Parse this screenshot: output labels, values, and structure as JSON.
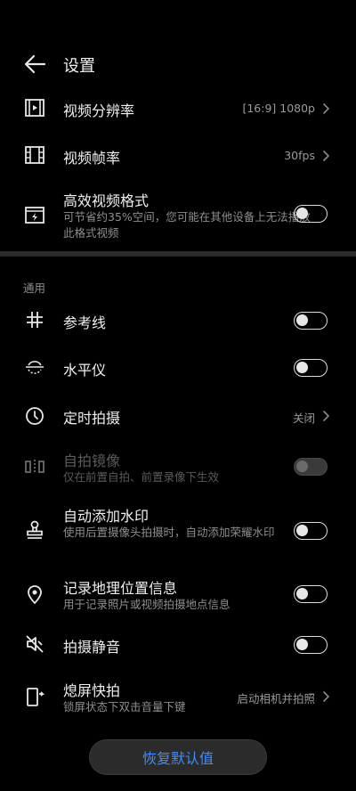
{
  "header": {
    "title": "设置"
  },
  "rows": {
    "resolution": {
      "label": "视频分辨率",
      "value": "[16:9] 1080p"
    },
    "framerate": {
      "label": "视频帧率",
      "value": "30fps"
    },
    "efficient": {
      "label": "高效视频格式",
      "sub": "可节省约35%空间，您可能在其他设备上无法播放此格式视频",
      "on": false
    },
    "gridlines": {
      "label": "参考线",
      "on": false
    },
    "level": {
      "label": "水平仪",
      "on": false
    },
    "timer": {
      "label": "定时拍摄",
      "value": "关闭"
    },
    "mirror": {
      "label": "自拍镜像",
      "sub": "仅在前置自拍、前置录像下生效",
      "on": false,
      "disabled": true
    },
    "watermark": {
      "label": "自动添加水印",
      "sub": "使用后置摄像头拍摄时，自动添加荣耀水印",
      "on": false
    },
    "location": {
      "label": "记录地理位置信息",
      "sub": "用于记录照片或视频拍摄地点信息",
      "on": false
    },
    "mute": {
      "label": "拍摄静音",
      "on": false
    },
    "quicksnap": {
      "label": "熄屏快拍",
      "sub": "锁屏状态下双击音量下键",
      "value": "启动相机并拍照"
    }
  },
  "section_general": "通用",
  "restore_button": "恢复默认值",
  "colors": {
    "background": "#000000",
    "accent": "#3d8bff",
    "divider": "#2a2a2a"
  }
}
